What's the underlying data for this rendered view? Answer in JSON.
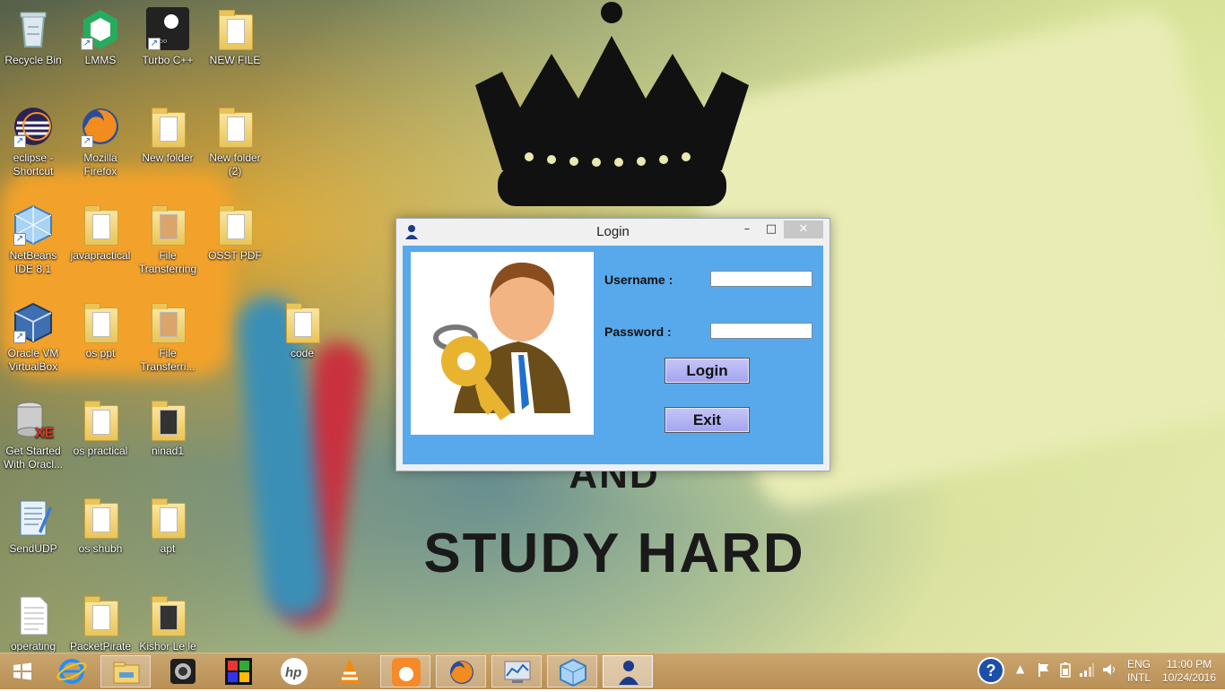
{
  "desktop": {
    "wallpaper_text": {
      "line1": "AND",
      "line2": "STUDY HARD"
    },
    "icons": [
      {
        "label": "Recycle Bin",
        "icon": "recycle-bin-icon"
      },
      {
        "label": "LMMS",
        "icon": "lmms-icon"
      },
      {
        "label": "Turbo C++",
        "icon": "turbo-cpp-icon"
      },
      {
        "label": "NEW FILE",
        "icon": "folder-icon"
      },
      {
        "label": "eclipse - Shortcut",
        "icon": "eclipse-icon"
      },
      {
        "label": "Mozilla Firefox",
        "icon": "firefox-icon"
      },
      {
        "label": "New folder",
        "icon": "folder-icon"
      },
      {
        "label": "New folder (2)",
        "icon": "folder-icon"
      },
      {
        "label": "NetBeans IDE 8.1",
        "icon": "netbeans-icon"
      },
      {
        "label": "javapractical",
        "icon": "folder-icon"
      },
      {
        "label": "File Transferring",
        "icon": "folder-icon"
      },
      {
        "label": "OSST PDF",
        "icon": "folder-icon"
      },
      {
        "label": "Oracle VM VirtualBox",
        "icon": "virtualbox-icon"
      },
      {
        "label": "os ppt",
        "icon": "folder-icon"
      },
      {
        "label": "File Transferri...",
        "icon": "folder-icon"
      },
      {
        "label": "code",
        "icon": "folder-icon"
      },
      {
        "label": "Get Started With Oracl...",
        "icon": "oracle-xe-icon"
      },
      {
        "label": "os practical",
        "icon": "folder-icon"
      },
      {
        "label": "ninad1",
        "icon": "folder-icon"
      },
      {
        "label": "SendUDP",
        "icon": "notepad-icon"
      },
      {
        "label": "os shubh",
        "icon": "folder-icon"
      },
      {
        "label": "apt",
        "icon": "folder-icon"
      },
      {
        "label": "operating system",
        "icon": "text-file-icon"
      },
      {
        "label": "PacketPirate",
        "icon": "folder-icon"
      },
      {
        "label": "Kishor Le le",
        "icon": "folder-icon"
      }
    ]
  },
  "login_window": {
    "title": "Login",
    "minimize_glyph": "–",
    "maximize_glyph": "□",
    "close_glyph": "✕",
    "username_label": "Username :",
    "password_label": "Password :",
    "username_value": "",
    "password_value": "",
    "login_button": "Login",
    "exit_button": "Exit"
  },
  "taskbar": {
    "pinned": [
      "windows-start-icon",
      "internet-explorer-icon",
      "file-explorer-icon",
      "webcam-icon",
      "colorful-app-icon",
      "hp-icon",
      "vlc-icon",
      "uc-browser-icon",
      "firefox-icon",
      "system-monitor-icon",
      "virtualbox-icon",
      "java-login-app-icon"
    ],
    "language": {
      "line1": "ENG",
      "line2": "INTL"
    },
    "time": "11:00 PM",
    "date": "10/24/2016"
  },
  "colors": {
    "client_bg": "#58a9ec",
    "button_bg": "#b4b4f4",
    "taskbar": "#c19a60"
  }
}
